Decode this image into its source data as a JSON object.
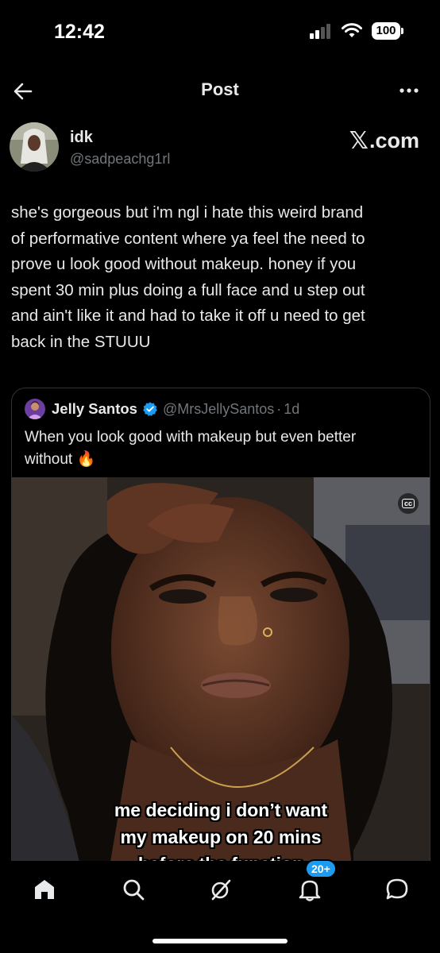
{
  "status_bar": {
    "time": "12:42",
    "battery": "100"
  },
  "nav": {
    "title": "Post"
  },
  "post": {
    "author_name": "idk",
    "author_handle": "@sadpeachg1rl",
    "source_label": "com",
    "text": "she's gorgeous but i'm ngl i hate this weird brand\nof performative content where ya feel the need to\nprove u look good without makeup. honey if you\nspent 30 min plus doing a full face and u step out\nand ain't like it and had to take it off u need to get\nback in the STUUU"
  },
  "quote": {
    "name": "Jelly Santos",
    "handle": "@MrsJellySantos",
    "separator": "·",
    "time": "1d",
    "text": "When you look good with makeup but even better\nwithout 🔥",
    "media": {
      "cc_label": "cc",
      "caption_lines": [
        "me deciding i don’t want",
        "my makeup on 20 mins",
        "before the function"
      ]
    }
  },
  "tabbar": {
    "notifications_badge": "20+"
  },
  "colors": {
    "accent": "#1d9bf0",
    "background": "#000000",
    "secondary_text": "#71767b",
    "border": "#2f3336"
  },
  "icons": {
    "back": "arrow-left-icon",
    "more": "more-horizontal-icon",
    "verified": "verified-badge-icon",
    "home": "home-icon",
    "search": "search-icon",
    "grok": "grok-icon",
    "notifications": "bell-icon",
    "messages": "message-icon"
  }
}
